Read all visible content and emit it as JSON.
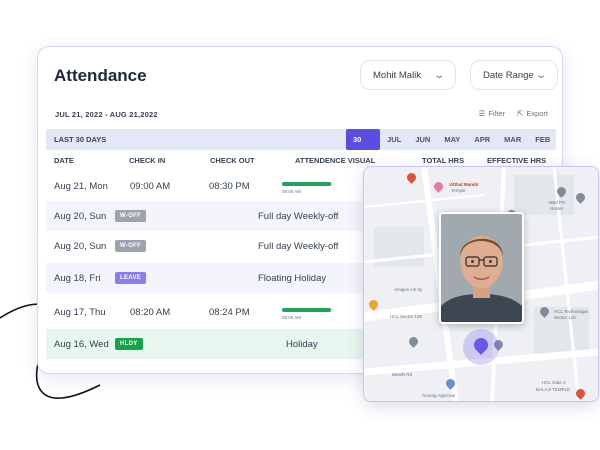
{
  "header": {
    "title": "Attendance",
    "employee_select": "Mohit Malik",
    "range_select": "Date Range"
  },
  "toolbar": {
    "date_range": "JUL 21, 2022 - AUG 21,2022",
    "filter_label": "Filter",
    "export_label": "Export"
  },
  "range_bar": {
    "label": "LAST 30 DAYS",
    "tabs": [
      "30 DAYS",
      "JUL",
      "JUN",
      "MAY",
      "APR",
      "MAR",
      "FEB"
    ]
  },
  "columns": [
    "DATE",
    "CHECK IN",
    "CHECK OUT",
    "ATTENDENCE VISUAL",
    "TOTAL HRS",
    "EFFECTIVE HRS"
  ],
  "rows": [
    {
      "date": "Aug 21, Mon",
      "check_in": "09:00 AM",
      "check_out": "08:30 PM",
      "bar_start": "09:00 AM",
      "progress": 0.95
    },
    {
      "date": "Aug 20, Sun",
      "badge": "W-OFF",
      "note": "Full day Weekly-off"
    },
    {
      "date": "Aug 20, Sun",
      "badge": "W-OFF",
      "note": "Full day Weekly-off"
    },
    {
      "date": "Aug 18, Fri",
      "badge": "LEAVE",
      "note": "Floating Holiday"
    },
    {
      "date": "Aug 17, Thu",
      "check_in": "08:20 AM",
      "check_out": "08:24 PM",
      "bar_start": "08:00 AM",
      "progress": 0.95
    },
    {
      "date": "Aug 16, Wed",
      "badge": "HLDY",
      "note": "Holiday"
    }
  ],
  "map": {
    "labels": {
      "vitthal": "Vitthal Mandir",
      "vitthal_sub": "Temple",
      "abm": "ABM PG",
      "abm_sub": "Hostel",
      "amigos": "Amigos inn by",
      "hcl126": "HCL Sector 126",
      "hcl_tech": "HCL Technologie",
      "hcl_tech_sub": "Sector 126",
      "hcl_gate": "HCL Gate 2",
      "balaji": "BALAJI TEMPLE",
      "arunag": "Arunag Approval",
      "bandh": "Bandh Rd"
    }
  },
  "colors": {
    "accent": "#5b4de0",
    "progress": "#22a35a",
    "woff": "#9ca3af",
    "leave": "#8b7df0",
    "holiday": "#16a34a"
  }
}
